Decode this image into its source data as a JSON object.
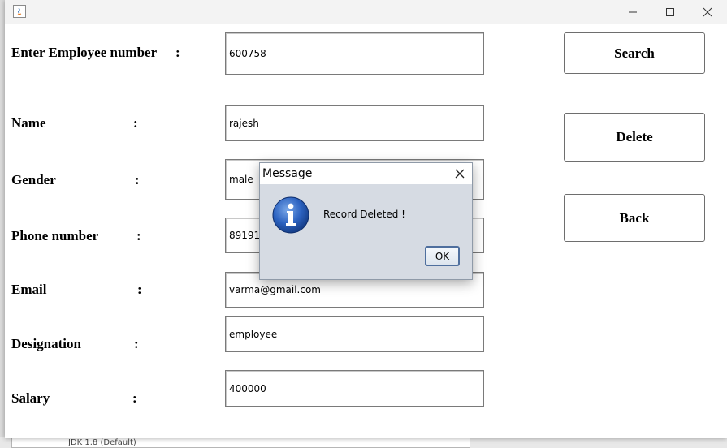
{
  "window": {
    "controls": {
      "minimize_icon": "minimize-icon",
      "maximize_icon": "maximize-icon",
      "close_icon": "close-icon"
    }
  },
  "form": {
    "employee_number": {
      "label": "Enter Employee number",
      "colon": ":",
      "value": "600758"
    },
    "name": {
      "label": "Name",
      "colon": ":",
      "value": "rajesh"
    },
    "gender": {
      "label": "Gender",
      "colon": ":",
      "value": "male"
    },
    "phone": {
      "label": "Phone number",
      "colon": ":",
      "value": "891910"
    },
    "email": {
      "label": "Email",
      "colon": ":",
      "value": "varma@gmail.com"
    },
    "designation": {
      "label": "Designation",
      "colon": ":",
      "value": "employee"
    },
    "salary": {
      "label": "Salary",
      "colon": ":",
      "value": "400000"
    }
  },
  "buttons": {
    "search": "Search",
    "delete": "Delete",
    "back": "Back"
  },
  "dialog": {
    "title": "Message",
    "message": "Record Deleted !",
    "ok_label": "OK",
    "icon": "info-icon"
  },
  "background": {
    "partial_text": "JDK 1.8 (Default)"
  }
}
